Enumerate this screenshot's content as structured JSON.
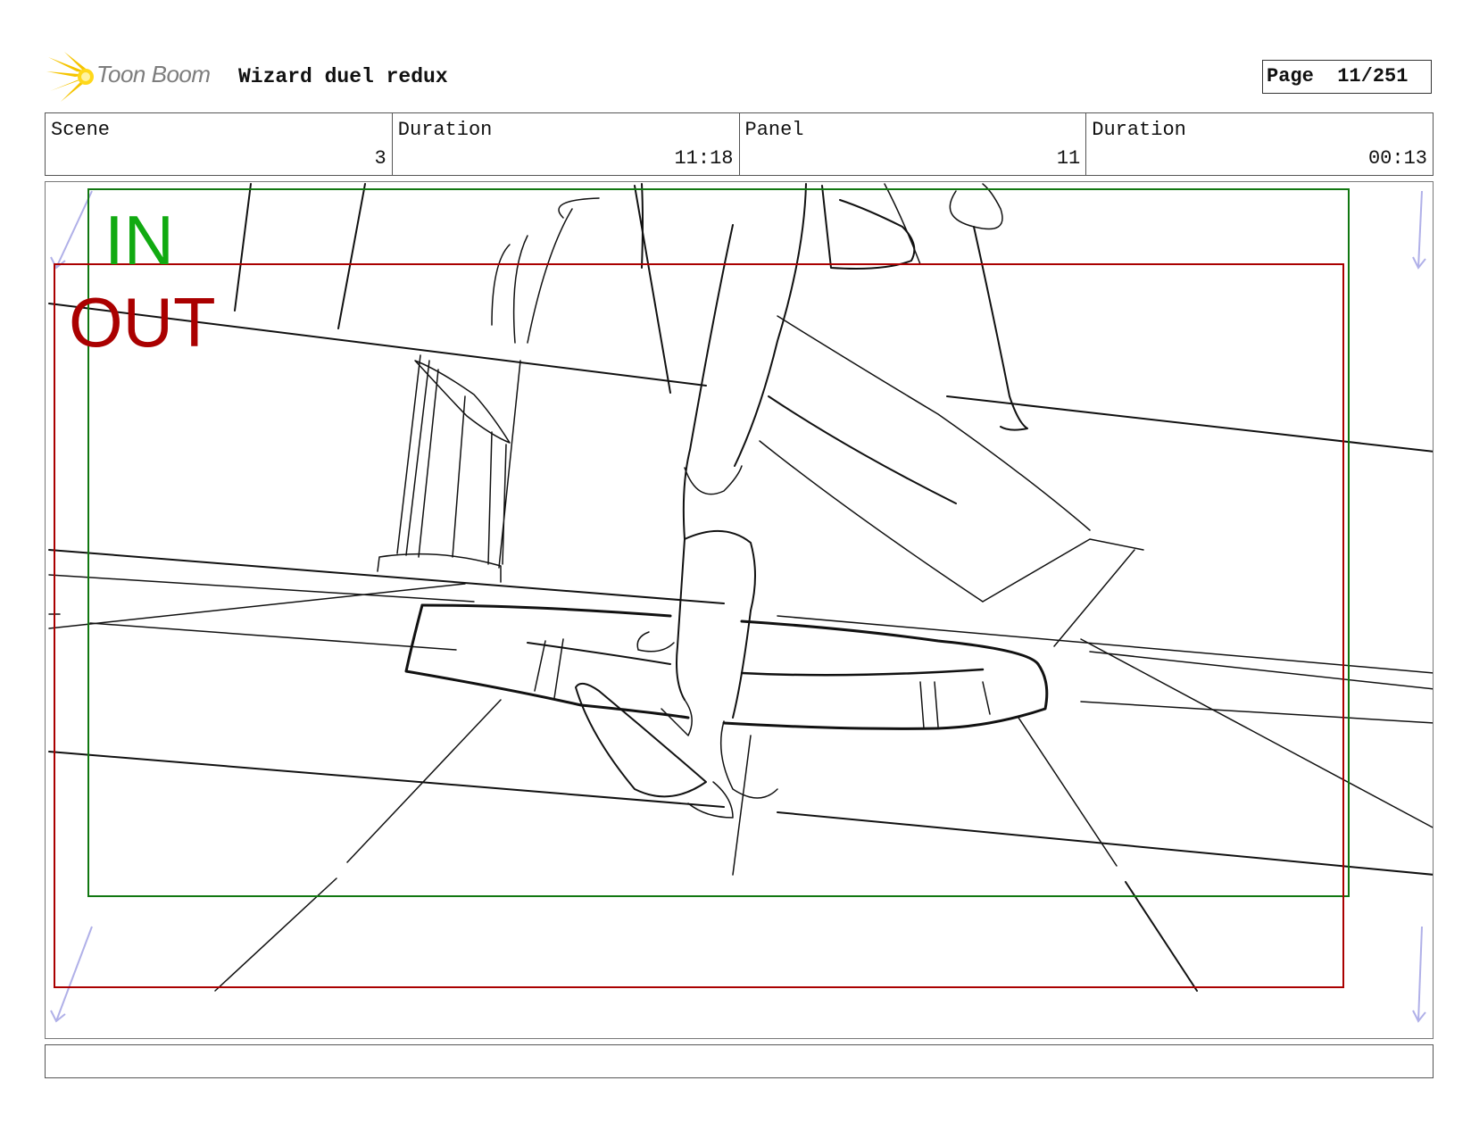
{
  "header": {
    "brand": "Toon Boom",
    "title": "Wizard duel redux",
    "page_label": "Page",
    "page_value": "11/251"
  },
  "info": [
    {
      "label": "Scene",
      "value": "3"
    },
    {
      "label": "Duration",
      "value": "11:18"
    },
    {
      "label": "Panel",
      "value": "11"
    },
    {
      "label": "Duration",
      "value": "00:13"
    }
  ],
  "panel": {
    "in_label": "IN",
    "out_label": "OUT",
    "colors": {
      "in_frame": "#117711",
      "out_frame": "#aa0000",
      "camera_arrows": "#b0b0e8"
    }
  },
  "caption": {
    "text": ""
  }
}
